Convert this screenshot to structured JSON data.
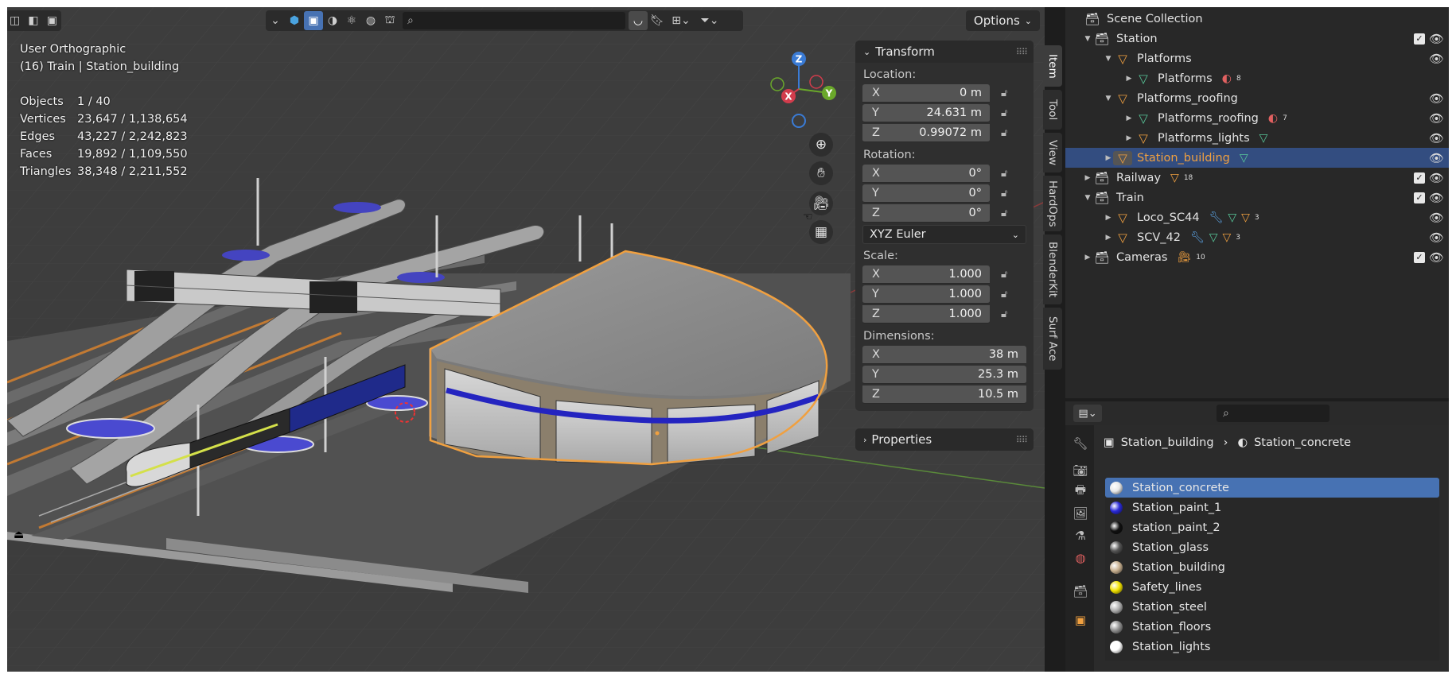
{
  "viewport": {
    "view_name": "User Orthographic",
    "context_line": "(16) Train | Station_building",
    "stats": [
      {
        "label": "Objects",
        "value": "1 / 40"
      },
      {
        "label": "Vertices",
        "value": "23,647 / 1,138,654"
      },
      {
        "label": "Edges",
        "value": "43,227 / 2,242,823"
      },
      {
        "label": "Faces",
        "value": "19,892 / 1,109,550"
      },
      {
        "label": "Triangles",
        "value": "38,348 / 2,211,552"
      }
    ],
    "options_label": "Options",
    "gizmo_axes": {
      "x": "X",
      "y": "Y",
      "z": "Z"
    }
  },
  "npanel": {
    "transform_title": "Transform",
    "location_label": "Location:",
    "location": [
      {
        "axis": "X",
        "value": "0 m"
      },
      {
        "axis": "Y",
        "value": "24.631 m"
      },
      {
        "axis": "Z",
        "value": "0.99072 m"
      }
    ],
    "rotation_label": "Rotation:",
    "rotation": [
      {
        "axis": "X",
        "value": "0°"
      },
      {
        "axis": "Y",
        "value": "0°"
      },
      {
        "axis": "Z",
        "value": "0°"
      }
    ],
    "rotation_mode": "XYZ Euler",
    "scale_label": "Scale:",
    "scale": [
      {
        "axis": "X",
        "value": "1.000"
      },
      {
        "axis": "Y",
        "value": "1.000"
      },
      {
        "axis": "Z",
        "value": "1.000"
      }
    ],
    "dimensions_label": "Dimensions:",
    "dimensions": [
      {
        "axis": "X",
        "value": "38 m"
      },
      {
        "axis": "Y",
        "value": "25.3 m"
      },
      {
        "axis": "Z",
        "value": "10.5 m"
      }
    ],
    "properties_title": "Properties",
    "tabs": [
      "Item",
      "Tool",
      "View",
      "HardOps",
      "BlenderKit",
      "Surf Ace"
    ]
  },
  "outliner": {
    "rows": [
      {
        "label": "Scene Collection"
      },
      {
        "label": "Station"
      },
      {
        "label": "Platforms"
      },
      {
        "label": "Platforms",
        "badge": "8"
      },
      {
        "label": "Platforms_roofing"
      },
      {
        "label": "Platforms_roofing",
        "badge": "7"
      },
      {
        "label": "Platforms_lights"
      },
      {
        "label": "Station_building"
      },
      {
        "label": "Railway",
        "badge": "18"
      },
      {
        "label": "Train"
      },
      {
        "label": "Loco_SC44",
        "badge": "3"
      },
      {
        "label": "SCV_42",
        "badge": "3"
      },
      {
        "label": "Cameras",
        "badge": "10"
      }
    ]
  },
  "properties": {
    "breadcrumb_object": "Station_building",
    "breadcrumb_material": "Station_concrete",
    "materials": [
      {
        "name": "Station_concrete",
        "color": "#e8e8e8"
      },
      {
        "name": "Station_paint_1",
        "color": "#2a2ad8"
      },
      {
        "name": "station_paint_2",
        "color": "#111111"
      },
      {
        "name": "Station_glass",
        "color": "#555555"
      },
      {
        "name": "Station_building",
        "color": "#c8b090"
      },
      {
        "name": "Safety_lines",
        "color": "#f2e200"
      },
      {
        "name": "Station_steel",
        "color": "#b0b0b0"
      },
      {
        "name": "Station_floors",
        "color": "#909090"
      },
      {
        "name": "Station_lights",
        "color": "#ffffff"
      }
    ]
  },
  "colors": {
    "accent": "#4772b3",
    "selection_outline": "#f0a040",
    "outliner_selected": "#334d80"
  }
}
